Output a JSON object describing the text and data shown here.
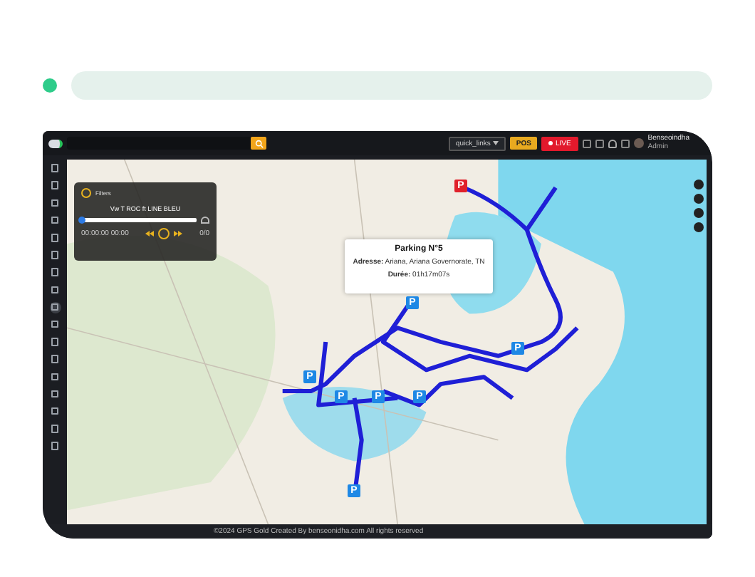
{
  "top_bar": {
    "quick_links": "quick_links",
    "pos_button": "POS",
    "live_button": "LIVE",
    "user": {
      "name": "Benseoindha",
      "role": "Admin"
    }
  },
  "sidebar": {
    "items": [
      {
        "selected": false
      },
      {
        "selected": false
      },
      {
        "selected": false
      },
      {
        "selected": false
      },
      {
        "selected": false
      },
      {
        "selected": false
      },
      {
        "selected": false
      },
      {
        "selected": false
      },
      {
        "selected": true
      },
      {
        "selected": false
      },
      {
        "selected": false
      },
      {
        "selected": false
      },
      {
        "selected": false
      },
      {
        "selected": false
      },
      {
        "selected": false
      },
      {
        "selected": false
      },
      {
        "selected": false
      }
    ]
  },
  "filters": {
    "title": "Filters",
    "route": "Vw T ROC ft LINE BLEU",
    "level": 0,
    "time": "00:00:00 00:00",
    "count": "0/0"
  },
  "popup": {
    "title": "Parking N°5",
    "lines": [
      "**Adresse:** Ariana, Ariana Governorate, TN",
      "**Durée:** 01h17m07s"
    ]
  },
  "markers": [
    {
      "label": "P",
      "kind": "end"
    },
    {
      "label": "P",
      "kind": "stop"
    },
    {
      "label": "P",
      "kind": "stop"
    },
    {
      "label": "P",
      "kind": "stop"
    },
    {
      "label": "P",
      "kind": "stop"
    },
    {
      "label": "P",
      "kind": "stop"
    },
    {
      "label": "P",
      "kind": "stop"
    },
    {
      "label": "P",
      "kind": "stop"
    }
  ],
  "footer": "©2024 GPS Gold Created By benseonidha.com All rights reserved"
}
